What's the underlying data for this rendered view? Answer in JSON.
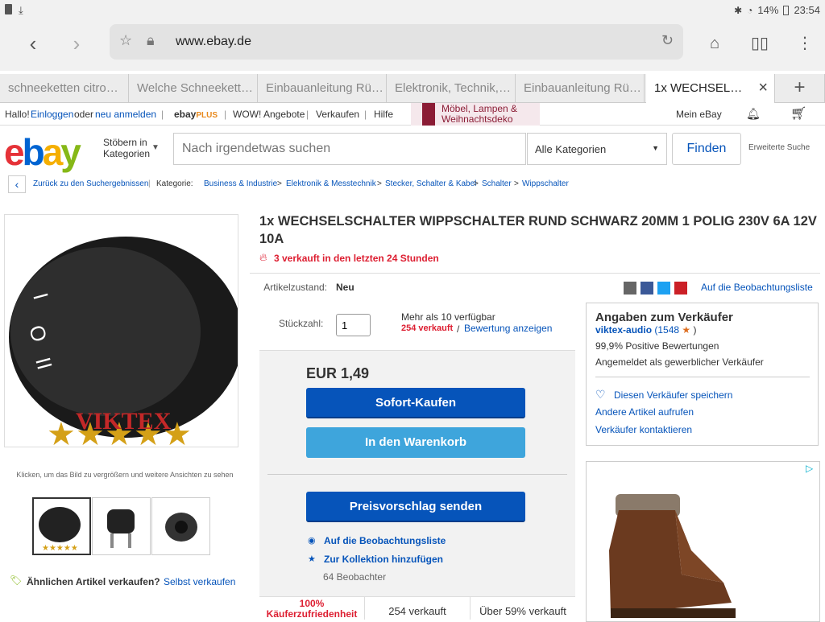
{
  "status": {
    "battery": "14%",
    "time": "23:54"
  },
  "browser": {
    "url": "www.ebay.de",
    "tabs": [
      {
        "label": "schneeketten citro…"
      },
      {
        "label": "Welche Schneekett…"
      },
      {
        "label": "Einbauanleitung Rü…"
      },
      {
        "label": "Elektronik, Technik,…"
      },
      {
        "label": "Einbauanleitung Rü…"
      },
      {
        "label": "1x WECHSEL…"
      }
    ]
  },
  "topnav": {
    "hallo": "Hallo!",
    "login": "Einloggen",
    "oder": "oder",
    "register": "neu anmelden",
    "ebayplus": "ebayPLUS",
    "wow": "WOW! Angebote",
    "sell": "Verkaufen",
    "help": "Hilfe",
    "banner": "Möbel, Lampen & Weihnachtsdeko",
    "my_ebay": "Mein eBay"
  },
  "header": {
    "browse": "Stöbern in Kategorien",
    "search_placeholder": "Nach irgendetwas suchen",
    "category": "Alle Kategorien",
    "find": "Finden",
    "advanced": "Erweiterte Suche"
  },
  "breadcrumb": {
    "back": "Zurück zu den Suchergebnissen",
    "category_label": "Kategorie:",
    "items": [
      "Business & Industrie",
      "Elektronik & Messtechnik",
      "Stecker, Schalter & Kabel",
      "Schalter",
      "Wippschalter"
    ]
  },
  "image": {
    "brand": "VIKTEX",
    "hint": "Klicken, um das Bild zu vergrößern und weitere Ansichten zu sehen"
  },
  "product": {
    "title": "1x WECHSELSCHALTER WIPPSCHALTER RUND SCHWARZ 20MM 1 POLIG 230V 6A 12V 10A",
    "hot": "3 verkauft in den letzten 24 Stunden",
    "condition_label": "Artikelzustand:",
    "condition": "Neu",
    "watch_link": "Auf die Beobachtungsliste",
    "qty_label": "Stückzahl:",
    "qty": "1",
    "available": "Mehr als 10 verfügbar",
    "sold": "254 verkauft",
    "slash": "/",
    "rating_link": "Bewertung anzeigen",
    "price": "EUR 1,49",
    "buy_now": "Sofort-Kaufen",
    "add_cart": "In den Warenkorb",
    "offer": "Preisvorschlag senden",
    "watch": "Auf die Beobachtungsliste",
    "collection": "Zur Kollektion hinzufügen",
    "watchers": "64 Beobachter",
    "stat1": "100%",
    "stat1b": "Käuferzufriedenheit",
    "stat2": "254 verkauft",
    "stat3": "Über 59% verkauft"
  },
  "seller": {
    "heading": "Angaben zum Verkäufer",
    "name": "viktex-audio",
    "score": "(1548",
    "close": ")",
    "positive": "99,9% Positive Bewertungen",
    "type": "Angemeldet als gewerblicher Verkäufer",
    "save": "Diesen Verkäufer speichern",
    "other": "Andere Artikel aufrufen",
    "contact": "Verkäufer kontaktieren"
  },
  "left": {
    "similar": "Ähnlichen Artikel verkaufen?",
    "self": "Selbst verkaufen"
  },
  "colors": {
    "blue": "#0654ba",
    "red": "#dd1e31"
  }
}
